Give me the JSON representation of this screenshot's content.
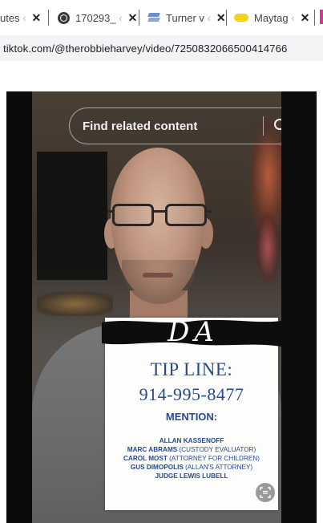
{
  "browser": {
    "tabs": [
      {
        "title": "utes",
        "favicon": "none"
      },
      {
        "title": "170293_",
        "favicon": "globe-icon"
      },
      {
        "title": "Turner v",
        "favicon": "layers-icon"
      },
      {
        "title": "Maytag",
        "favicon": "yellow-pill-icon"
      }
    ],
    "close_glyph": "✕",
    "url": "tiktok.com/@therobbieharvey/video/7250832066500414766"
  },
  "video": {
    "search_placeholder": "Find related content",
    "card": {
      "signature": "DA",
      "heading": "TIP LINE:",
      "phone": "914-995-8477",
      "mention_label": "MENTION:",
      "names": [
        {
          "name": "ALLAN KASSENOFF",
          "role": ""
        },
        {
          "name": "MARC ABRAMS",
          "role": " (CUSTODY EVALUATOR)"
        },
        {
          "name": "CAROL MOST",
          "role": " (ATTORNEY FOR CHILDREN)"
        },
        {
          "name": "GUS DIMOPOLIS",
          "role": " (ALLAN'S ATTORNEY)"
        },
        {
          "name": "JUDGE LEWIS LUBELL",
          "role": ""
        }
      ]
    }
  },
  "colors": {
    "card_text": "#274a8c",
    "address_bar_bg": "#f1f3f4"
  }
}
